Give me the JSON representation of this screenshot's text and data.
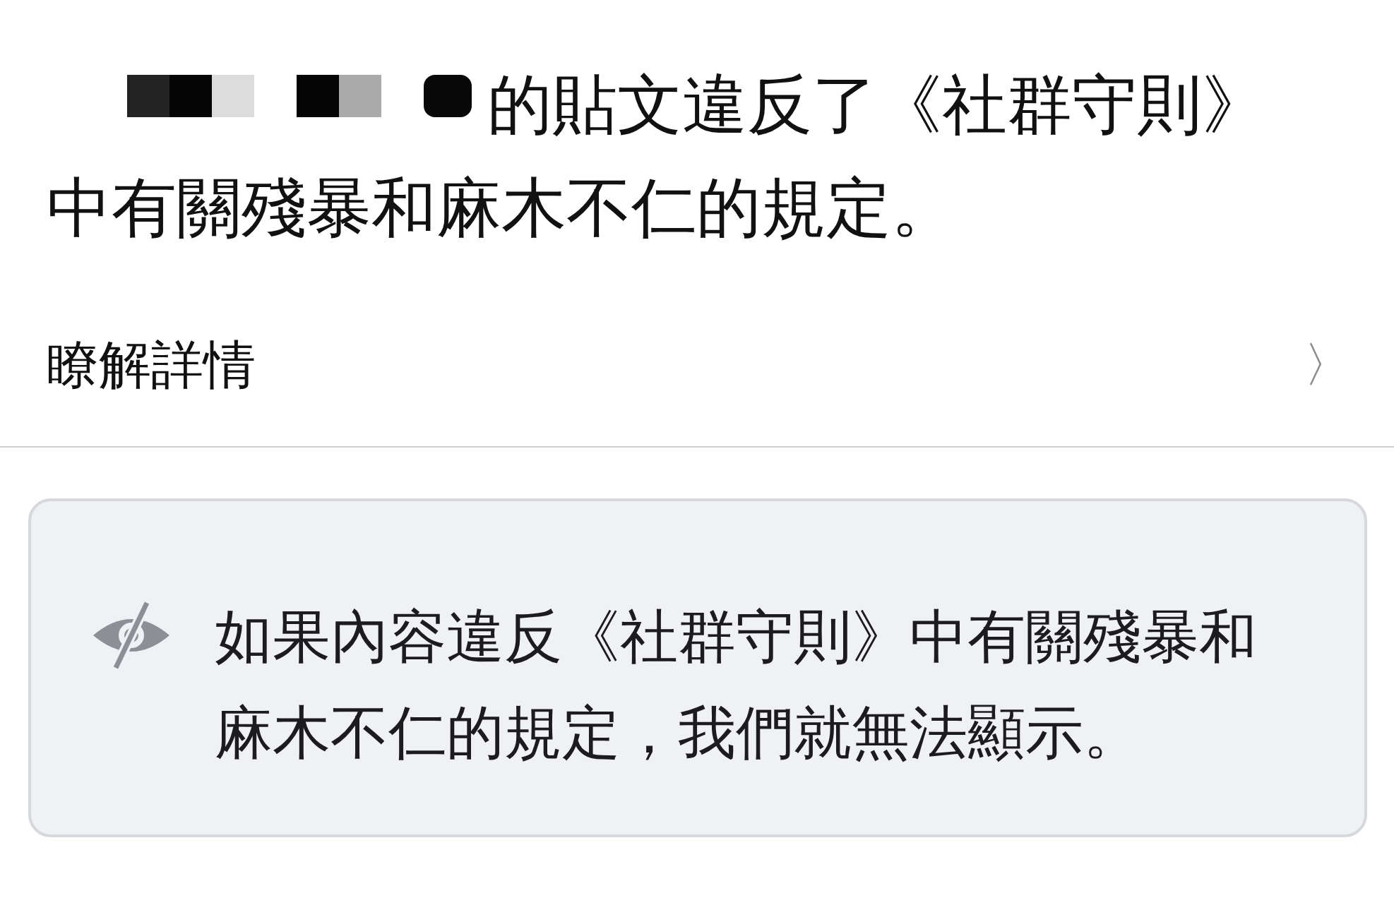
{
  "violation_message_lines": [
    "的貼文違反了《社群守則》",
    "中有關殘暴和麻木不仁的規定。"
  ],
  "learn_more": {
    "label": "瞭解詳情",
    "chevron": "〉"
  },
  "notice": {
    "text": "如果內容違反《社群守則》中有關殘暴和麻木不仁的規定，我們就無法顯示。"
  }
}
